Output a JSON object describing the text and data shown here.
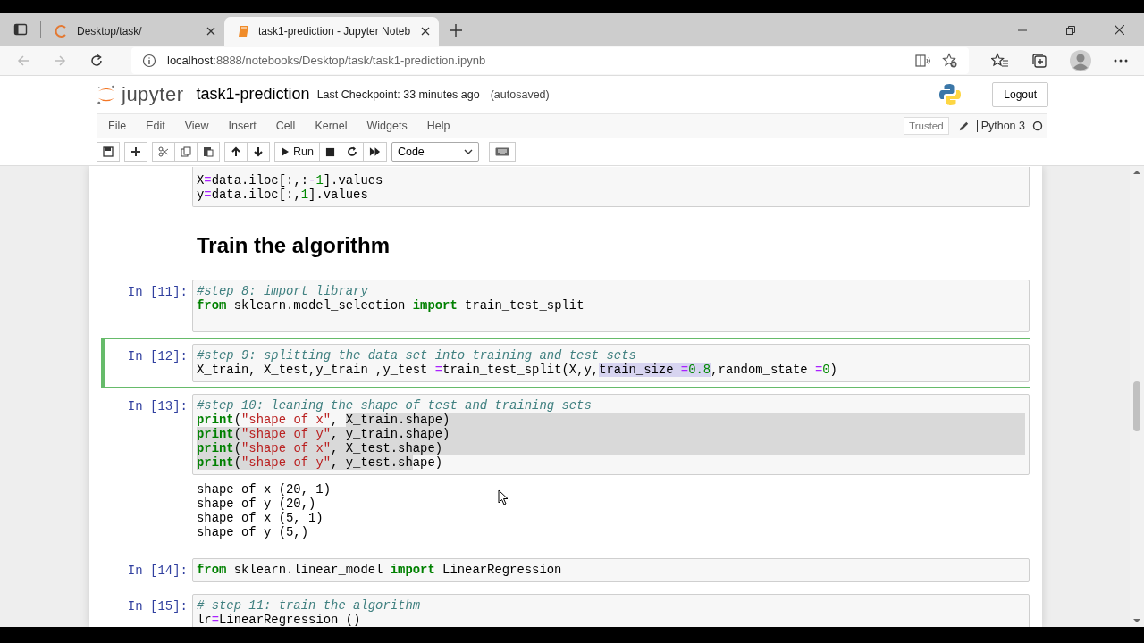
{
  "browser": {
    "tabs": [
      {
        "title": "Desktop/task/",
        "selected": false
      },
      {
        "title": "task1-prediction - Jupyter Noteb",
        "selected": true
      }
    ],
    "url": {
      "host": "localhost",
      "path": ":8888/notebooks/Desktop/task/task1-prediction.ipynb"
    }
  },
  "header": {
    "logo": "jupyter",
    "notebook_name": "task1-prediction",
    "checkpoint": "Last Checkpoint: 33 minutes ago",
    "autosave": "(autosaved)",
    "logout": "Logout"
  },
  "menu": [
    "File",
    "Edit",
    "View",
    "Insert",
    "Cell",
    "Kernel",
    "Widgets",
    "Help"
  ],
  "toolbar": {
    "run": "Run",
    "cell_type": "Code",
    "trusted": "Trusted",
    "kernel": "Python 3",
    "kernel_busy": false
  },
  "cells": [
    {
      "kind": "code",
      "selected": false,
      "lines": [
        {
          "selected": false,
          "tokens": [
            {
              "text": "X",
              "kind": "plain",
              "selected": false
            },
            {
              "text": "=",
              "kind": "op",
              "selected": false
            },
            {
              "text": "data.iloc[:,:",
              "kind": "plain",
              "selected": false
            },
            {
              "text": "-",
              "kind": "op",
              "selected": false
            },
            {
              "text": "1",
              "kind": "num",
              "selected": false
            },
            {
              "text": "].values",
              "kind": "plain",
              "selected": false
            }
          ]
        },
        {
          "selected": false,
          "tokens": [
            {
              "text": "y",
              "kind": "plain",
              "selected": false
            },
            {
              "text": "=",
              "kind": "op",
              "selected": false
            },
            {
              "text": "data.iloc[:,",
              "kind": "plain",
              "selected": false
            },
            {
              "text": "1",
              "kind": "num",
              "selected": false
            },
            {
              "text": "].values",
              "kind": "plain",
              "selected": false
            }
          ]
        }
      ]
    },
    {
      "kind": "markdown",
      "heading": "Train the algorithm"
    },
    {
      "kind": "code",
      "prompt": "In [11]:",
      "selected": false,
      "lines": [
        {
          "selected": false,
          "tokens": [
            {
              "text": "#step 8: import library",
              "kind": "comment",
              "selected": false
            }
          ]
        },
        {
          "selected": false,
          "tokens": [
            {
              "text": "from",
              "kind": "kw",
              "selected": false
            },
            {
              "text": " sklearn.model_selection ",
              "kind": "plain",
              "selected": false
            },
            {
              "text": "import",
              "kind": "kw",
              "selected": false
            },
            {
              "text": " train_test_split",
              "kind": "plain",
              "selected": false
            }
          ]
        },
        {
          "selected": false
        }
      ]
    },
    {
      "kind": "code",
      "prompt": "In [12]:",
      "selected": true,
      "lines": [
        {
          "selected": false,
          "tokens": [
            {
              "text": "#step 9: splitting the data set into training and test sets",
              "kind": "comment",
              "selected": false
            }
          ]
        },
        {
          "selected": false,
          "tokens": [
            {
              "text": "X_train, X_test,y_train ,y_test ",
              "kind": "plain",
              "selected": false
            },
            {
              "text": "=",
              "kind": "op",
              "selected": false
            },
            {
              "text": "train_test_split(X,y,",
              "kind": "plain",
              "selected": false
            },
            {
              "text": "train_size ",
              "kind": "plain",
              "selected": true
            },
            {
              "text": "=",
              "kind": "op",
              "selected": true
            },
            {
              "text": "0.8",
              "kind": "num",
              "selected": true
            },
            {
              "text": ",random_state ",
              "kind": "plain",
              "selected": false
            },
            {
              "text": "=",
              "kind": "op",
              "selected": false
            },
            {
              "text": "0",
              "kind": "num",
              "selected": false
            },
            {
              "text": ")",
              "kind": "plain",
              "selected": false
            }
          ]
        }
      ]
    },
    {
      "kind": "code",
      "prompt": "In [13]:",
      "selected": false,
      "lines": [
        {
          "selected": false,
          "tokens": [
            {
              "text": "#step 10: leaning the shape of test and training sets",
              "kind": "comment",
              "selected": false
            }
          ]
        },
        {
          "selected": true,
          "tokens": [
            {
              "text": "print",
              "kind": "builtin",
              "selected": false
            },
            {
              "text": "(",
              "kind": "plain",
              "selected": false
            },
            {
              "text": "\"shape of x\"",
              "kind": "str",
              "selected": false
            },
            {
              "text": ", ",
              "kind": "plain",
              "selected": false
            },
            {
              "text": "X_train.shape)",
              "kind": "plain",
              "selected": true
            }
          ]
        },
        {
          "selected": true,
          "tokens": [
            {
              "text": "print",
              "kind": "builtin",
              "selected": true
            },
            {
              "text": "(",
              "kind": "plain",
              "selected": true
            },
            {
              "text": "\"shape of y\"",
              "kind": "str",
              "selected": true
            },
            {
              "text": ", y_train.shape)",
              "kind": "plain",
              "selected": true
            }
          ]
        },
        {
          "selected": true,
          "tokens": [
            {
              "text": "print",
              "kind": "builtin",
              "selected": true
            },
            {
              "text": "(",
              "kind": "plain",
              "selected": true
            },
            {
              "text": "\"shape of x\"",
              "kind": "str",
              "selected": true
            },
            {
              "text": ", X_test.shape)",
              "kind": "plain",
              "selected": true
            }
          ]
        },
        {
          "selected": false,
          "tokens": [
            {
              "text": "print",
              "kind": "builtin",
              "selected": true
            },
            {
              "text": "(",
              "kind": "plain",
              "selected": true
            },
            {
              "text": "\"shape of y\"",
              "kind": "str",
              "selected": true
            },
            {
              "text": ", y_test.sh",
              "kind": "plain",
              "selected": true
            },
            {
              "text": "ape)",
              "kind": "plain",
              "selected": false
            }
          ]
        }
      ],
      "output": [
        "shape of x (20, 1)",
        "shape of y (20,)",
        "shape of x (5, 1)",
        "shape of y (5,)"
      ]
    },
    {
      "kind": "code",
      "prompt": "In [14]:",
      "selected": false,
      "lines": [
        {
          "selected": false,
          "tokens": [
            {
              "text": "from",
              "kind": "kw",
              "selected": false
            },
            {
              "text": " sklearn.linear_model ",
              "kind": "plain",
              "selected": false
            },
            {
              "text": "import",
              "kind": "kw",
              "selected": false
            },
            {
              "text": " LinearRegression",
              "kind": "plain",
              "selected": false
            }
          ]
        }
      ]
    },
    {
      "kind": "code",
      "prompt": "In [15]:",
      "selected": false,
      "lines": [
        {
          "selected": false,
          "tokens": [
            {
              "text": "# step 11: train the algorithm",
              "kind": "comment",
              "selected": false
            }
          ]
        },
        {
          "selected": false,
          "tokens": [
            {
              "text": "lr",
              "kind": "plain",
              "selected": false
            },
            {
              "text": "=",
              "kind": "op",
              "selected": false
            },
            {
              "text": "LinearRegression ()",
              "kind": "plain",
              "selected": false
            }
          ]
        }
      ]
    }
  ]
}
